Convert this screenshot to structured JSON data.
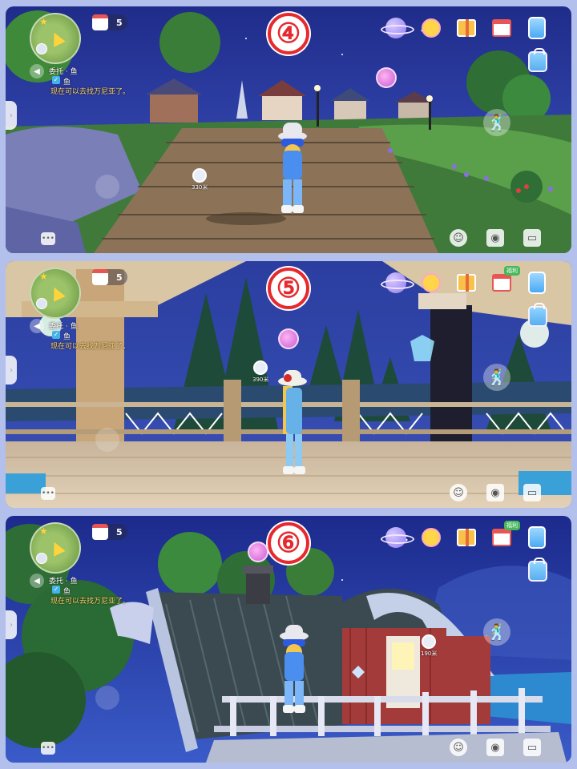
{
  "panels": [
    {
      "number": "④",
      "calendar_count": "5",
      "quest_title": "委托 · 鱼",
      "quest_item": "鱼",
      "quest_desc": "现在可以去找万尼亚了。",
      "marker_distance": "330米",
      "basket_tag": ""
    },
    {
      "number": "⑤",
      "calendar_count": "5",
      "quest_title": "委托 · 鱼",
      "quest_item": "鱼",
      "quest_desc": "现在可以去找万尼亚了。",
      "marker_distance": "390米",
      "basket_tag": "福利"
    },
    {
      "number": "⑥",
      "calendar_count": "5",
      "quest_title": "委托 · 鱼",
      "quest_item": "鱼",
      "quest_desc": "现在可以去找万尼亚了。",
      "marker_distance": "190米",
      "basket_tag": "福利"
    }
  ],
  "icons": [
    "planet-icon",
    "bird-icon",
    "gift-icon",
    "basket-icon",
    "phone-icon",
    "backpack-icon",
    "dance-icon",
    "emote-icon",
    "camera-icon",
    "toolbox-icon",
    "chat-icon"
  ],
  "colors": {
    "badge_red": "#e52a2f",
    "frame": "#b3c0ec",
    "quest_desc": "#ffd86a"
  }
}
